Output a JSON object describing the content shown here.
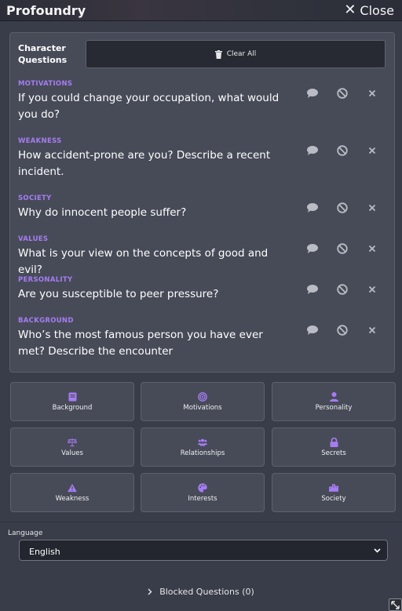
{
  "window": {
    "title": "Profoundry",
    "close_label": "Close"
  },
  "panel": {
    "heading": "Character Questions",
    "clear_all_label": "Clear All"
  },
  "questions": [
    {
      "category": "MOTIVATIONS",
      "text": "If you could change your occupation, what would you do?"
    },
    {
      "category": "WEAKNESS",
      "text": "How accident-prone are you? Describe a recent incident."
    },
    {
      "category": "SOCIETY",
      "text": "Why do innocent people suffer?"
    },
    {
      "category": "VALUES",
      "text": "What is your view on the concepts of good and evil?"
    },
    {
      "category": "PERSONALITY",
      "text": "Are you susceptible to peer pressure?"
    },
    {
      "category": "BACKGROUND",
      "text": "Who’s the most famous person you have ever met? Describe the encounter"
    }
  ],
  "question_actions": [
    "comment-icon",
    "block-icon",
    "remove-icon"
  ],
  "categories": [
    {
      "label": "Background",
      "icon": "book-icon"
    },
    {
      "label": "Motivations",
      "icon": "target-icon"
    },
    {
      "label": "Personality",
      "icon": "person-icon"
    },
    {
      "label": "Values",
      "icon": "scale-icon"
    },
    {
      "label": "Relationships",
      "icon": "people-icon"
    },
    {
      "label": "Secrets",
      "icon": "lock-icon"
    },
    {
      "label": "Weakness",
      "icon": "warning-icon"
    },
    {
      "label": "Interests",
      "icon": "palette-icon"
    },
    {
      "label": "Society",
      "icon": "city-icon"
    }
  ],
  "language": {
    "label": "Language",
    "selected": "English"
  },
  "blocked": {
    "label": "Blocked Questions (0)"
  },
  "colors": {
    "accent": "#a67cf2",
    "background": "#393d4a",
    "panel": "#474b58",
    "button_dark": "#272a33"
  }
}
